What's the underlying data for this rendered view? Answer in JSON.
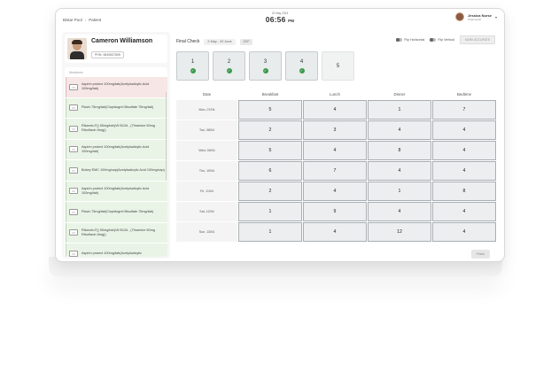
{
  "breadcrumb": {
    "root": "Bistar Pool",
    "separator": "›",
    "current": "Patient"
  },
  "clock": {
    "date": "23 May 2024",
    "time": "06:56",
    "ampm": "PM"
  },
  "user": {
    "name": "Jessica Nurse",
    "role": "Pharmacist"
  },
  "patient": {
    "name": "Cameron Williamson",
    "phn": "PHN: 9849837895"
  },
  "medicines": {
    "title": "Medicines",
    "items": [
      {
        "text": "Aspirin protect 100mg/tab(Acetylsalicylic Acid 100mg/tab)",
        "status": "red"
      },
      {
        "text": "Plavix 75mg/tab(Clopidogrel Bisulfate 75mg/tab)",
        "status": "green"
      },
      {
        "text": "Rikamin-F() 50mg/tab(Vit B12d , (Thiamine 50mg Riboflavin 5mg))",
        "status": "green"
      },
      {
        "text": "Aspirin protect 100mg/tab(Acetylsalicylic Acid 100mg/tab)",
        "status": "green"
      },
      {
        "text": "Bokey EMC 100mg/cap(Acetylsalicylic Acid 100mg/cap)",
        "status": "green"
      },
      {
        "text": "Aspirin protect 100mg/tab(Acetylsalicylic Acid 100mg/tab)",
        "status": "green"
      },
      {
        "text": "Plavix 75mg/tab(Clopidogrel Bisulfate 75mg/tab)",
        "status": "green"
      },
      {
        "text": "Rikamin-F() 50mg/tab(Vit B12d , (Thiamine 50mg Riboflavin 5mg))",
        "status": "green"
      },
      {
        "text": "Aspirin protect 100mg/tab(Acetylsalicylic",
        "status": "green"
      }
    ]
  },
  "toolbar": {
    "title": "Final Check",
    "range": "2 May - 20 June",
    "dsp": "DSP",
    "flip_horizontal": "Flip Horizontal",
    "flip_vertical": "Flip Vertical",
    "mark_accurate": "MARK ACCURATE"
  },
  "steps": [
    {
      "label": "1",
      "done": true
    },
    {
      "label": "2",
      "done": true
    },
    {
      "label": "3",
      "done": true
    },
    {
      "label": "4",
      "done": true
    },
    {
      "label": "5",
      "done": false
    }
  ],
  "grid": {
    "headers": [
      "Date",
      "Breakfast",
      "Lunch",
      "Dinner",
      "Bedtime"
    ],
    "rows": [
      {
        "date": "Mon, 07/04",
        "values": [
          "5",
          "4",
          "1",
          "7"
        ]
      },
      {
        "date": "Tue, 08/04",
        "values": [
          "2",
          "3",
          "4",
          "4"
        ]
      },
      {
        "date": "Wed, 09/04",
        "values": [
          "5",
          "4",
          "8",
          "4"
        ]
      },
      {
        "date": "Thu, 10/04",
        "values": [
          "6",
          "7",
          "4",
          "4"
        ]
      },
      {
        "date": "Fri, 11/04",
        "values": [
          "2",
          "4",
          "1",
          "8"
        ]
      },
      {
        "date": "Sat, 12/04",
        "values": [
          "1",
          "9",
          "4",
          "4"
        ]
      },
      {
        "date": "Sun, 13/04",
        "values": [
          "1",
          "4",
          "12",
          "4"
        ]
      }
    ]
  },
  "finish_label": "Finish",
  "colors": {
    "check": "#3a9a4b",
    "red_row": "#f7e6e6",
    "green_row": "#eaf4e6"
  }
}
